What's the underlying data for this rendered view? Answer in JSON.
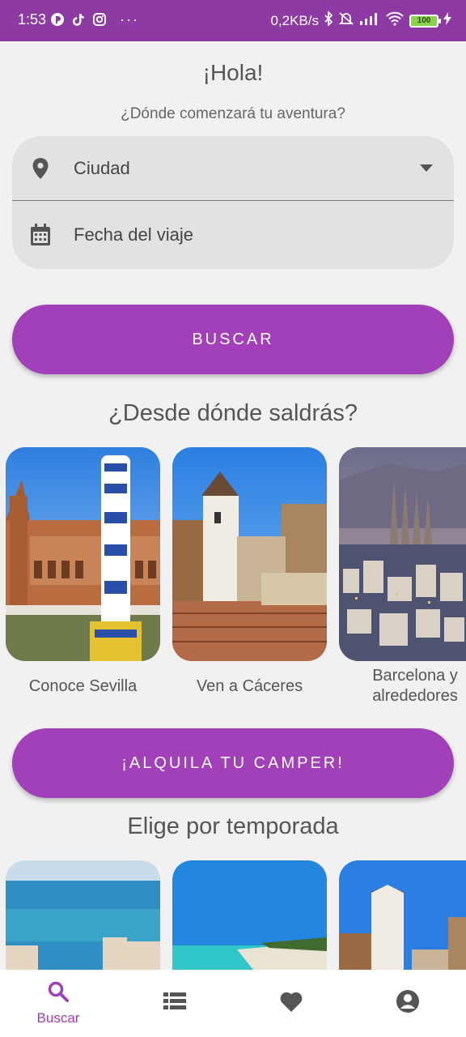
{
  "status_bar": {
    "time": "1:53",
    "speed": "0,2KB/s",
    "battery": "100",
    "more": "···"
  },
  "greeting": "¡Hola!",
  "subtitle": "¿Dónde comenzará tu aventura?",
  "search": {
    "city_label": "Ciudad",
    "city_icon": "location-pin-icon",
    "date_label": "Fecha del viaje",
    "date_icon": "calendar-icon"
  },
  "buscar_button": "BUSCAR",
  "section_departure": "¿Desde dónde saldrás?",
  "departure_cards": [
    {
      "caption": "Conoce Sevilla"
    },
    {
      "caption": "Ven a Cáceres"
    },
    {
      "caption": "Barcelona y alrededores"
    }
  ],
  "camper_button": "¡ALQUILA TU CAMPER!",
  "section_season": "Elige por temporada",
  "bottom_nav": {
    "items": [
      {
        "label": "Buscar",
        "icon": "search-icon",
        "active": true
      },
      {
        "label": "",
        "icon": "list-icon"
      },
      {
        "label": "",
        "icon": "heart-icon"
      },
      {
        "label": "",
        "icon": "account-icon"
      }
    ],
    "active_color": "#a040b8",
    "inactive_color": "#555555"
  },
  "colors": {
    "status_bar": "#8e3aa4",
    "accent": "#a140b8",
    "background": "#f1f1f1"
  }
}
